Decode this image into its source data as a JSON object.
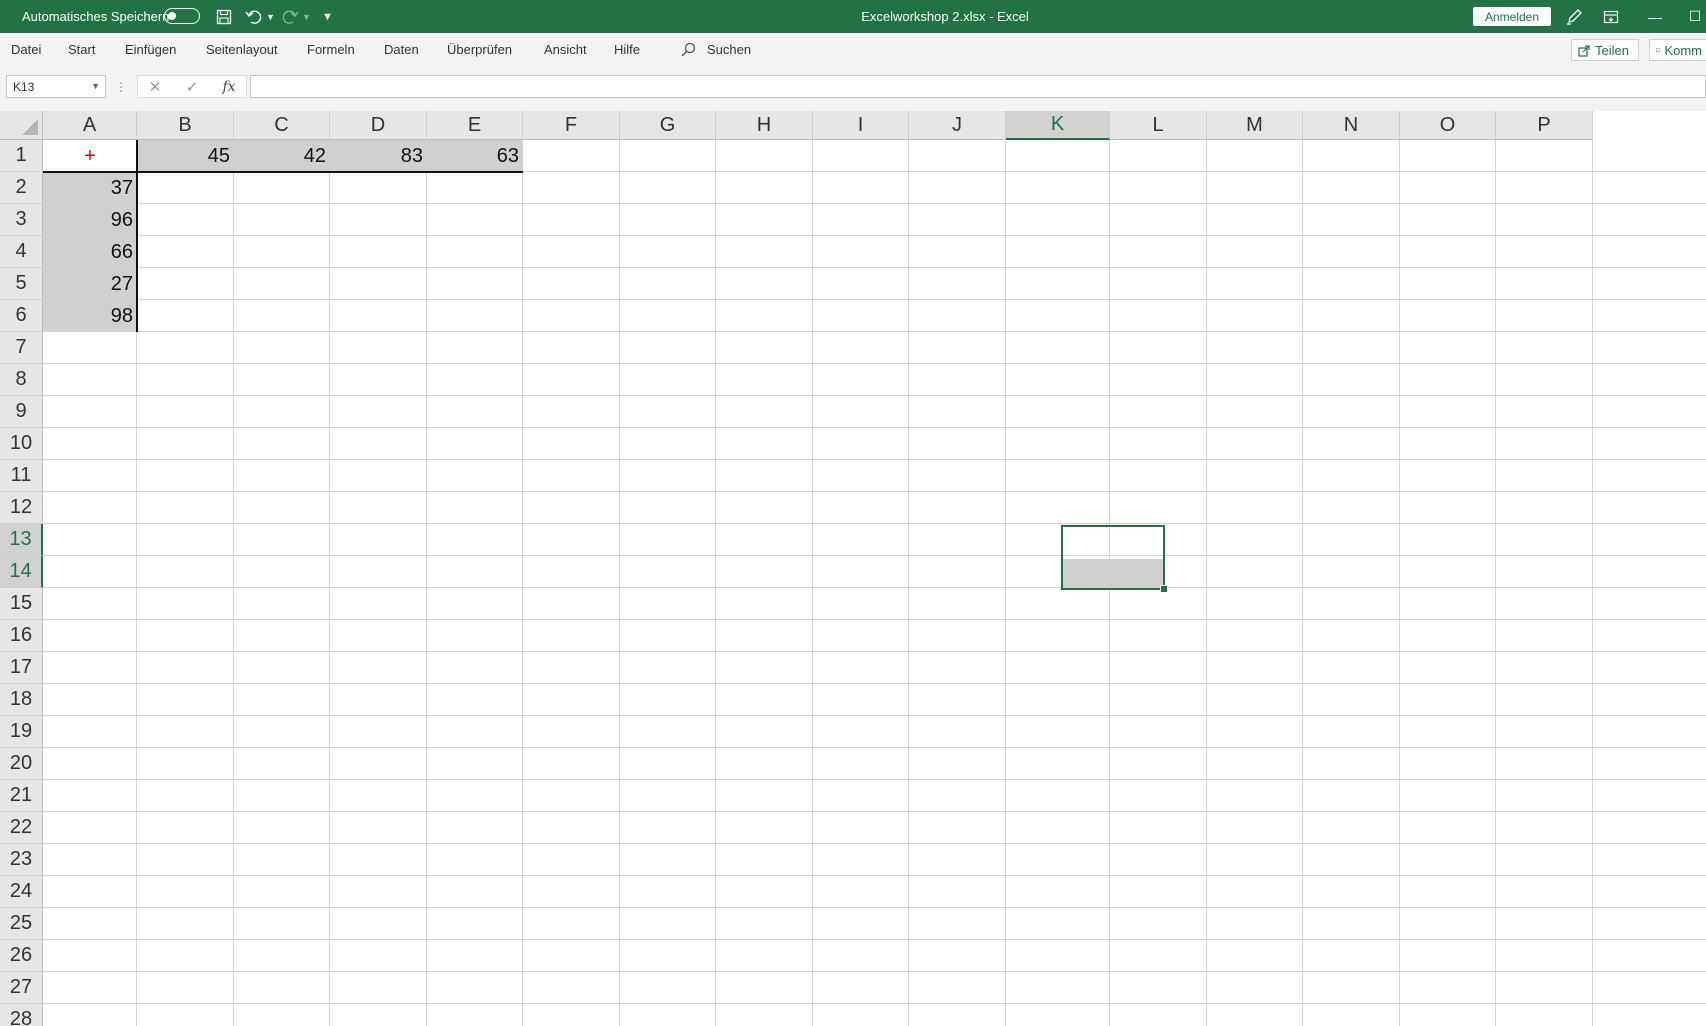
{
  "titlebar": {
    "autosave_label": "Automatisches Speichern",
    "title": "Excelworkshop 2.xlsx  -  Excel",
    "signin_label": "Anmelden"
  },
  "ribbon": {
    "tabs": [
      "Datei",
      "Start",
      "Einfügen",
      "Seitenlayout",
      "Formeln",
      "Daten",
      "Überprüfen",
      "Ansicht",
      "Hilfe"
    ],
    "search_label": "Suchen",
    "share_label": "Teilen",
    "comments_label": "Komm"
  },
  "formula_bar": {
    "name_box": "K13",
    "fx_label": "fx",
    "formula_value": ""
  },
  "sheet": {
    "columns": [
      "A",
      "B",
      "C",
      "D",
      "E",
      "F",
      "G",
      "H",
      "I",
      "J",
      "K",
      "L",
      "M",
      "N",
      "O",
      "P"
    ],
    "rows": [
      "1",
      "2",
      "3",
      "4",
      "5",
      "6",
      "7",
      "8",
      "9",
      "10",
      "11",
      "12",
      "13",
      "14",
      "15",
      "16",
      "17",
      "18",
      "19",
      "20",
      "21",
      "22",
      "23",
      "24",
      "25",
      "26",
      "27",
      "28"
    ],
    "selected_column": "K",
    "selected_rows": [
      "13",
      "14"
    ],
    "operator": "+",
    "header_values": [
      "45",
      "42",
      "83",
      "63"
    ],
    "row_values": [
      "37",
      "96",
      "66",
      "27",
      "98"
    ]
  },
  "colors": {
    "accent": "#217346",
    "operator": "#e00000",
    "shade": "#d0d0d0"
  }
}
